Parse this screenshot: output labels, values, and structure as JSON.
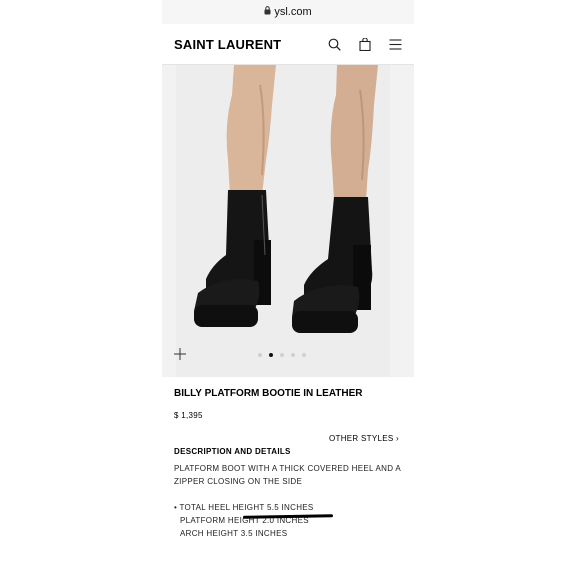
{
  "browser": {
    "url": "ysl.com"
  },
  "header": {
    "logo": "SAINT LAURENT",
    "icons": [
      "search-icon",
      "bag-icon",
      "menu-icon"
    ]
  },
  "gallery": {
    "dots": 5,
    "active_index": 1
  },
  "product": {
    "title": "BILLY PLATFORM BOOTIE IN LEATHER",
    "price": "$ 1,395",
    "other_styles": "OTHER STYLES ›",
    "description_heading": "DESCRIPTION AND DETAILS",
    "description_line1": "PLATFORM BOOT WITH A THICK COVERED HEEL AND A",
    "description_line2": "ZIPPER CLOSING ON THE SIDE",
    "detail1": "• TOTAL HEEL HEIGHT 5.5 INCHES",
    "detail2": "PLATFORM HEIGHT 2.0 INCHES",
    "detail3": "ARCH HEIGHT 3.5 INCHES"
  }
}
